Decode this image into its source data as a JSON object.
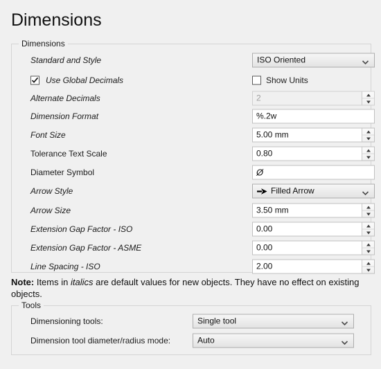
{
  "page": {
    "title": "Dimensions"
  },
  "dimensions_group": {
    "legend": "Dimensions",
    "rows": [
      {
        "key": "standard_and_style",
        "label": "Standard and Style",
        "italic": true,
        "control": "combo",
        "value": "ISO Oriented"
      },
      {
        "key": "use_global_decimals",
        "label": "Use Global Decimals",
        "italic": true,
        "control": "checkbox_pair",
        "checked": true,
        "right_label": "Show Units",
        "right_checked": false
      },
      {
        "key": "alternate_decimals",
        "label": "Alternate Decimals",
        "italic": true,
        "control": "spinner",
        "value": "2",
        "disabled": true
      },
      {
        "key": "dimension_format",
        "label": "Dimension Format",
        "italic": true,
        "control": "text",
        "value": "%.2w"
      },
      {
        "key": "font_size",
        "label": "Font Size",
        "italic": true,
        "control": "spinner",
        "value": "5.00 mm"
      },
      {
        "key": "tolerance_text_scale",
        "label": "Tolerance Text Scale",
        "italic": false,
        "control": "spinner",
        "value": "0.80"
      },
      {
        "key": "diameter_symbol",
        "label": "Diameter Symbol",
        "italic": false,
        "control": "text",
        "value": "Ø",
        "value_italic": true
      },
      {
        "key": "arrow_style",
        "label": "Arrow Style",
        "italic": true,
        "control": "combo",
        "value": "Filled Arrow",
        "icon": "filled-arrow-icon"
      },
      {
        "key": "arrow_size",
        "label": "Arrow Size",
        "italic": true,
        "control": "spinner",
        "value": "3.50 mm"
      },
      {
        "key": "extension_gap_factor_iso",
        "label": "Extension Gap Factor - ISO",
        "italic": true,
        "control": "spinner",
        "value": "0.00"
      },
      {
        "key": "extension_gap_factor_asme",
        "label": "Extension Gap Factor - ASME",
        "italic": true,
        "control": "spinner",
        "value": "0.00"
      },
      {
        "key": "line_spacing_iso",
        "label": "Line Spacing - ISO",
        "italic": true,
        "control": "spinner",
        "value": "2.00"
      }
    ]
  },
  "note": {
    "prefix": "Note:",
    "part1": " Items in ",
    "emphasis": "italics",
    "part2": " are default values for new objects. They have no effect on existing objects."
  },
  "tools_group": {
    "legend": "Tools",
    "rows": [
      {
        "key": "dimensioning_tools",
        "label": "Dimensioning tools:",
        "value": "Single tool"
      },
      {
        "key": "dimension_tool_mode",
        "label": "Dimension tool diameter/radius mode:",
        "value": "Auto"
      }
    ]
  },
  "colors": {
    "background": "#f0f0f0",
    "field_background": "#ffffff",
    "border": "#c0c0c0",
    "group_border": "#d4d4d4",
    "text": "#1a1a1a",
    "disabled_text": "#a0a0a0"
  }
}
